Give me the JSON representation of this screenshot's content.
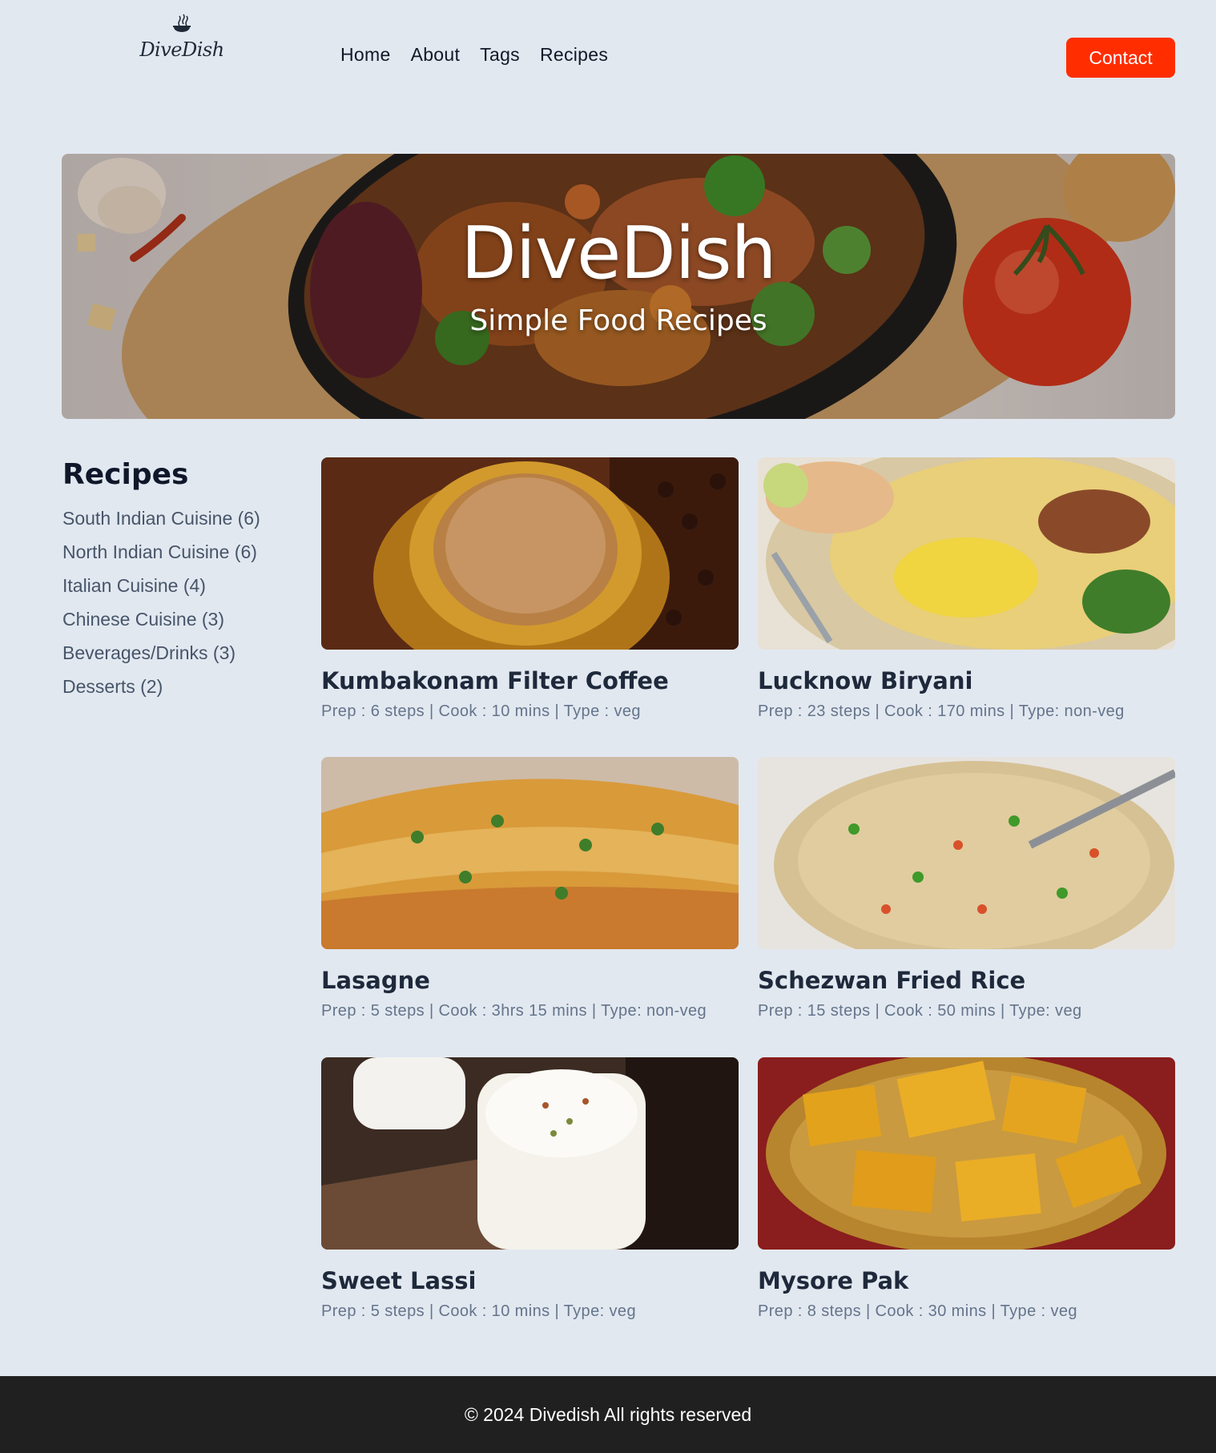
{
  "brand": {
    "name": "DiveDish"
  },
  "nav": {
    "items": [
      "Home",
      "About",
      "Tags",
      "Recipes"
    ],
    "contact_label": "Contact"
  },
  "hero": {
    "title": "DiveDish",
    "subtitle": "Simple Food Recipes"
  },
  "sidebar": {
    "heading": "Recipes",
    "categories": [
      "South Indian Cuisine (6)",
      "North Indian Cuisine (6)",
      "Italian Cuisine (4)",
      "Chinese Cuisine (3)",
      "Beverages/Drinks (3)",
      "Desserts (2)"
    ]
  },
  "recipes": [
    {
      "title": "Kumbakonam Filter Coffee",
      "meta": "Prep : 6 steps | Cook : 10 mins | Type : veg"
    },
    {
      "title": "Lucknow Biryani",
      "meta": "Prep : 23 steps | Cook : 170 mins | Type: non-veg"
    },
    {
      "title": "Lasagne",
      "meta": "Prep : 5 steps | Cook : 3hrs 15 mins | Type: non-veg"
    },
    {
      "title": "Schezwan Fried Rice",
      "meta": "Prep : 15 steps | Cook : 50 mins | Type: veg"
    },
    {
      "title": "Sweet Lassi",
      "meta": "Prep : 5 steps | Cook : 10 mins | Type: veg"
    },
    {
      "title": "Mysore Pak",
      "meta": "Prep : 8 steps | Cook : 30 mins | Type : veg"
    }
  ],
  "footer": {
    "text": "© 2024 Divedish All rights reserved"
  },
  "colors": {
    "background": "#e2e8f0",
    "accent": "#ff2d00",
    "footer": "#202020"
  }
}
